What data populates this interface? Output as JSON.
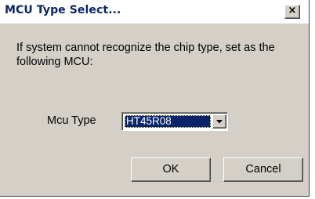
{
  "window": {
    "title": "MCU Type Select...",
    "close_glyph": "×",
    "message": "If system cannot recognize the chip type, set as the following MCU:"
  },
  "mcu": {
    "label": "Mcu Type",
    "selected": "HT45R08",
    "dropdown_icon": "chevron-down-icon"
  },
  "buttons": {
    "ok_label": "OK",
    "cancel_label": "Cancel"
  },
  "colors": {
    "title_text": "#0a246a",
    "dialog_face": "#d4d0c8",
    "selection_bg": "#0a246a",
    "selection_text": "#ffffff"
  }
}
